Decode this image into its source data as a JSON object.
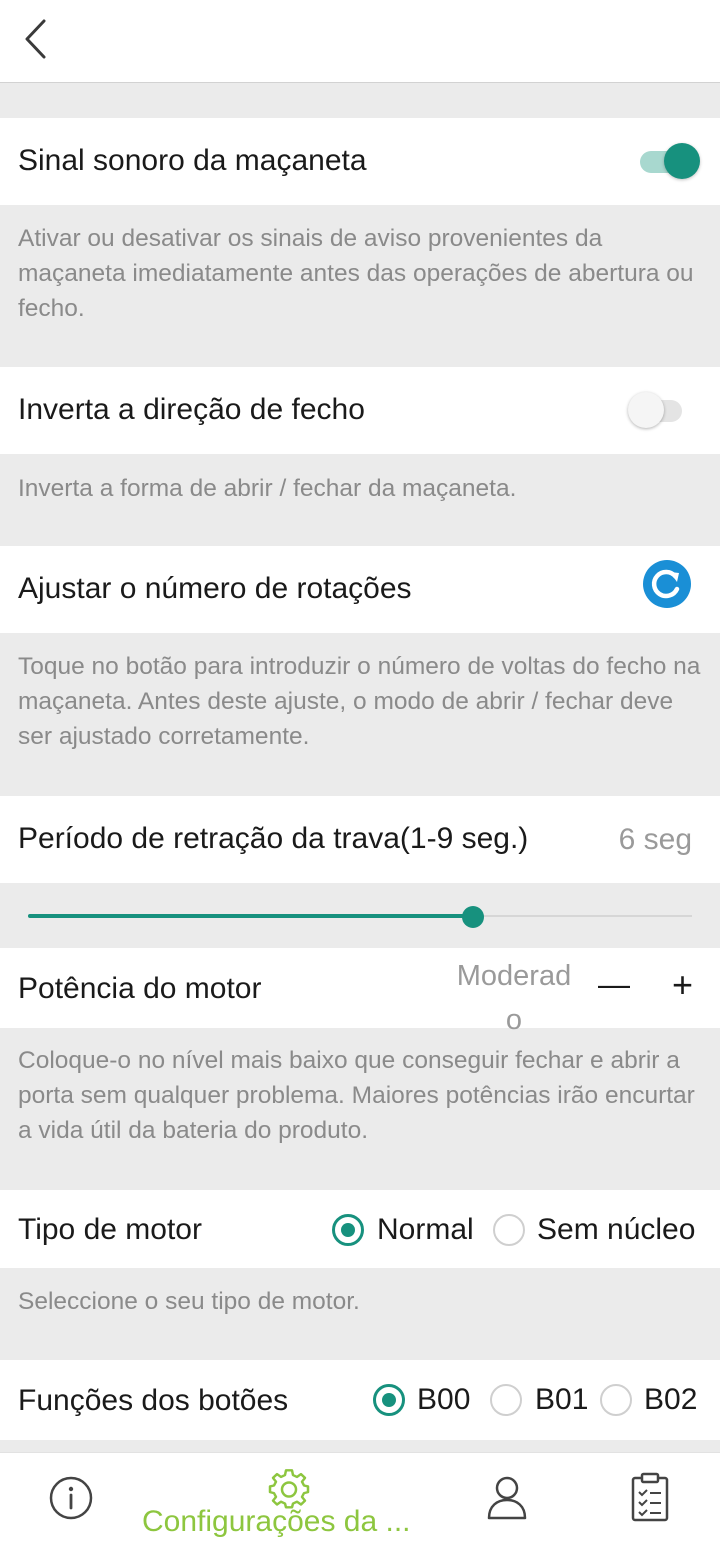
{
  "header": {
    "back_icon": "chevron-left-icon"
  },
  "settings": {
    "handle_beep": {
      "title": "Sinal sonoro da maçaneta",
      "enabled": true,
      "description": "Ativar ou desativar os sinais de aviso provenientes da maçaneta imediatamente antes das operações de abertura ou fecho."
    },
    "invert_direction": {
      "title": "Inverta a direção de fecho",
      "enabled": false,
      "description": "Inverta a forma de abrir / fechar da maçaneta."
    },
    "rotations": {
      "title": "Ajustar o número de rotações",
      "icon": "refresh-icon",
      "description": "Toque no botão para introduzir o número de voltas do fecho na maçaneta. Antes deste ajuste, o modo de abrir / fechar deve ser ajustado corretamente."
    },
    "latch_retraction": {
      "title": "Período de retração da trava(1-9 seg.)",
      "value_label": "6 seg",
      "value": 6,
      "min": 1,
      "max": 9,
      "fill_fraction": 0.67
    },
    "motor_power": {
      "title": "Potência do motor",
      "value_line1": "Moderad",
      "value_line2": "o",
      "minus": "—",
      "plus": "+",
      "description": "Coloque-o no nível mais baixo que conseguir fechar e abrir a porta sem qualquer problema. Maiores potências irão encurtar a vida útil da bateria do produto."
    },
    "motor_type": {
      "title": "Tipo de motor",
      "options": [
        "Normal",
        "Sem núcleo"
      ],
      "selected": "Normal",
      "description": "Seleccione o seu tipo de motor."
    },
    "button_functions": {
      "title": "Funções dos botões",
      "options": [
        "B00",
        "B01",
        "B02"
      ],
      "selected": "B00"
    }
  },
  "bottom_nav": {
    "items": [
      {
        "icon": "info-icon",
        "label": ""
      },
      {
        "icon": "gear-icon",
        "label": "Configurações da ..."
      },
      {
        "icon": "user-icon",
        "label": ""
      },
      {
        "icon": "clipboard-icon",
        "label": ""
      }
    ],
    "active_color": "#8dc63f"
  },
  "colors": {
    "accent": "#17917e",
    "refresh_blue": "#1a8fd6",
    "nav_green": "#8dc63f"
  }
}
